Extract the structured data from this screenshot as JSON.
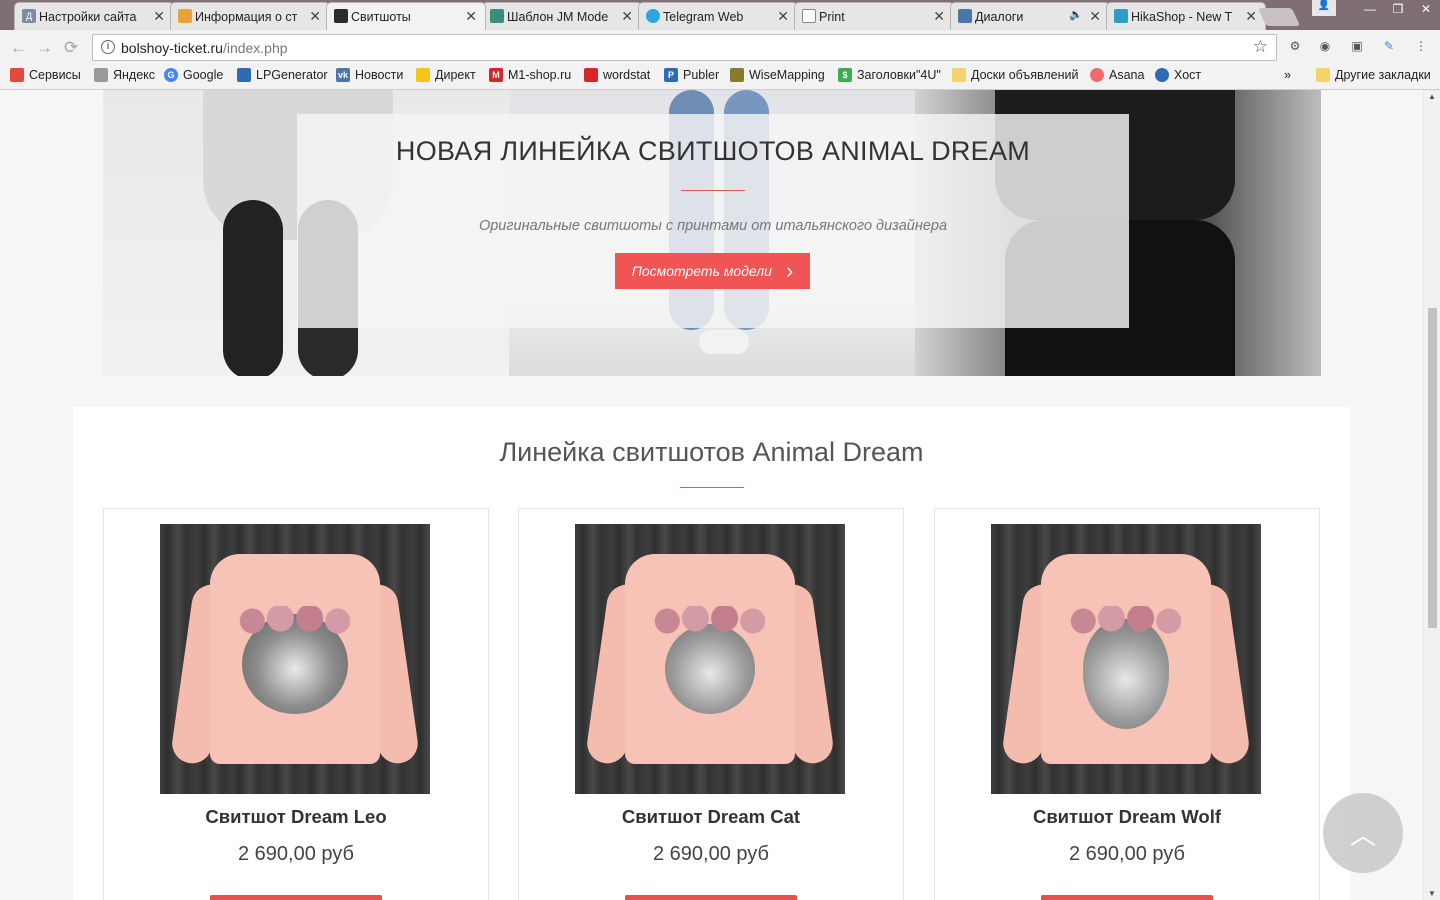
{
  "tabs": [
    {
      "title": "Настройки сайта",
      "favicon_color": "#7d8ca3",
      "favicon_letter": "Д"
    },
    {
      "title": "Информация о ст",
      "favicon_color": "#e8a23b"
    },
    {
      "title": "Свитшоты",
      "favicon_color": "#2b2b2b",
      "active": true
    },
    {
      "title": "Шаблон JM Mode",
      "favicon_color": "#3a8c7c"
    },
    {
      "title": "Telegram Web",
      "favicon_color": "#2ca5e0"
    },
    {
      "title": "Print",
      "favicon_color": "#ffffff"
    },
    {
      "title": "Диалоги",
      "favicon_color": "#4a76a8"
    },
    {
      "title": "HikaShop - New T",
      "favicon_color": "#2d9cc7"
    }
  ],
  "address_bar": {
    "domain": "bolshoy-ticket.ru",
    "path": "/index.php"
  },
  "bookmarks": [
    {
      "label": "Сервисы",
      "color": "#e24a3b"
    },
    {
      "label": "Яндекс",
      "color": "#999999"
    },
    {
      "label": "Google",
      "color": "#4285f4"
    },
    {
      "label": "LPGenerator",
      "color": "#2e6bb5"
    },
    {
      "label": "Новости",
      "color": "#4a76a8"
    },
    {
      "label": "Директ",
      "color": "#f5c518"
    },
    {
      "label": "M1-shop.ru",
      "color": "#d6262b"
    },
    {
      "label": "wordstat",
      "color": "#d6262b"
    },
    {
      "label": "Publer",
      "color": "#2e6bb5"
    },
    {
      "label": "WiseMapping",
      "color": "#8a7b2a"
    },
    {
      "label": "Заголовки\"4U\"",
      "color": "#3bab54"
    },
    {
      "label": "Доски объявлений",
      "color": "#f5d36b"
    },
    {
      "label": "Asana",
      "color": "#f06a6a"
    },
    {
      "label": "Хост",
      "color": "#2e6bb5"
    }
  ],
  "bookmarks_more": "»",
  "other_bookmarks": "Другие закладки",
  "hero": {
    "title": "НОВАЯ ЛИНЕЙКА СВИТШОТОВ ANIMAL DREAM",
    "subtitle": "Оригинальные свитшоты с принтами от итальянского дизайнера",
    "button_label": "Посмотреть модели",
    "button_color": "#f05454"
  },
  "section": {
    "title": "Линейка свитшотов Animal Dream",
    "accent_color": "#e45858"
  },
  "products": [
    {
      "name": "Свитшот Dream Leo",
      "price": "2 690,00 руб",
      "animal": "lion"
    },
    {
      "name": "Свитшот Dream Cat",
      "price": "2 690,00 руб",
      "animal": "cat"
    },
    {
      "name": "Свитшот Dream Wolf",
      "price": "2 690,00 руб",
      "animal": "wolf"
    }
  ],
  "icons": {
    "back": "←",
    "forward": "→",
    "reload": "⟳",
    "star": "☆",
    "close": "✕",
    "chevron_right": "›",
    "arrow_up": "︿"
  }
}
